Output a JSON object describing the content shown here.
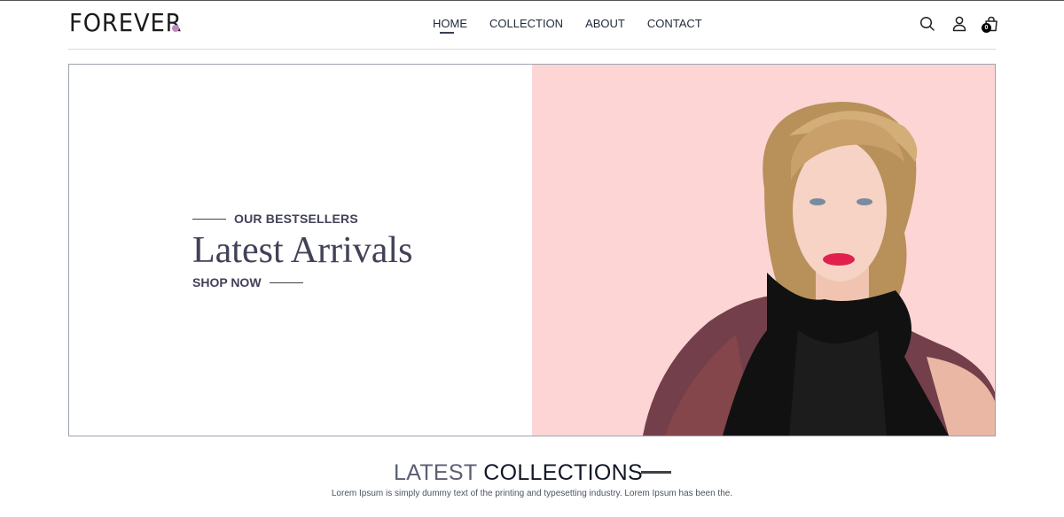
{
  "brand": {
    "logo_text": "FOREVER",
    "logo_dot_color": "#c586c0"
  },
  "nav": {
    "links": [
      "HOME",
      "COLLECTION",
      "ABOUT",
      "CONTACT"
    ],
    "active": "HOME",
    "icons": [
      "search-icon",
      "user-icon",
      "cart-icon"
    ],
    "cart_count": "0"
  },
  "hero": {
    "tag": "OUR BESTSELLERS",
    "title": "Latest Arrivals",
    "cta": "SHOP NOW",
    "image_bg_color": "#fdd5d5"
  },
  "latest": {
    "title_part1": "LATEST",
    "title_part2": "COLLECTIONS",
    "description": "Lorem Ipsum is simply dummy text of the printing and typesetting industry. Lorem Ipsum has been the."
  }
}
